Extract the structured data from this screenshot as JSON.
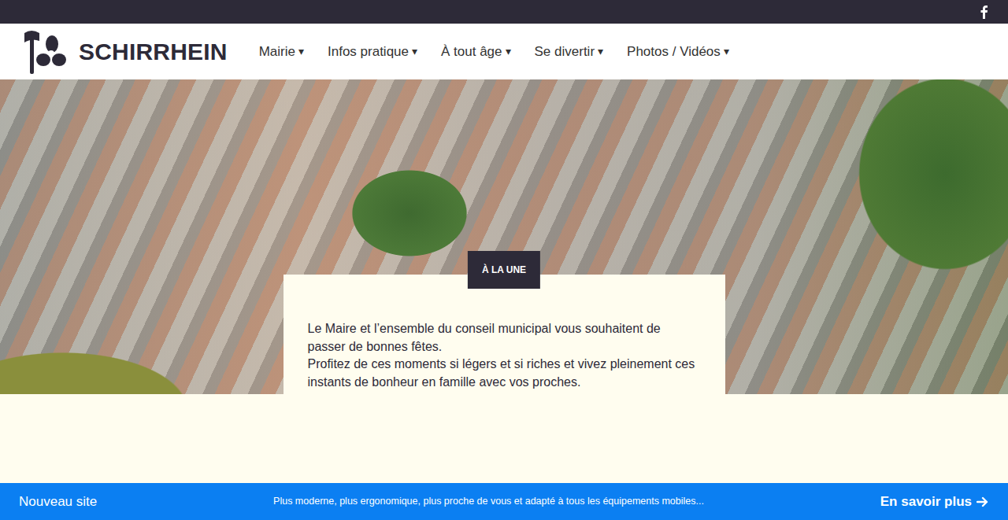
{
  "logo": {
    "text": "SCHIRRHEIN"
  },
  "menu": [
    {
      "label": "Mairie",
      "caret": "▾"
    },
    {
      "label": "Infos pratique",
      "caret": "▾"
    },
    {
      "label": "À tout âge",
      "caret": "▾"
    },
    {
      "label": "Se divertir",
      "caret": "▾"
    },
    {
      "label": "Photos / Vidéos",
      "caret": "▾"
    }
  ],
  "feature": {
    "badge": "À LA UNE",
    "paragraphs": [
      "Le Maire et l’ensemble du conseil municipal vous souhaitent de passer de bonnes fêtes.",
      "Profitez de ces moments si légers et si riches et vivez pleinement ces instants de bonheur en famille avec vos proches."
    ]
  },
  "notice": {
    "title": "Nouveau site",
    "text": "Plus moderne, plus ergonomique, plus proche de vous et adapté à tous les équipements mobiles...",
    "link": "En savoir plus"
  }
}
